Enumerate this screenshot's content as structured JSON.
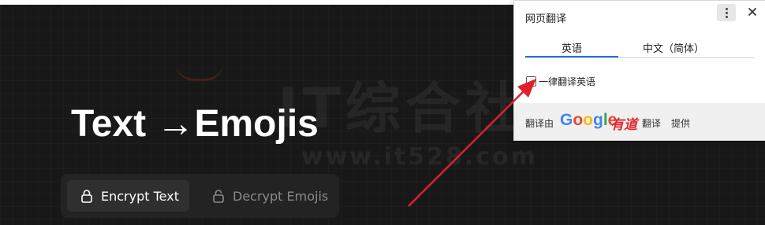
{
  "page": {
    "hero_title": "Text →Emojis",
    "watermark": "IT综合社区",
    "watermark_url": "www.it528.com",
    "modes": [
      {
        "label": "Encrypt Text",
        "icon": "lock-icon",
        "active": true
      },
      {
        "label": "Decrypt Emojis",
        "icon": "unlock-icon",
        "active": false
      }
    ]
  },
  "translate_popup": {
    "title": "网页翻译",
    "tabs": [
      {
        "label": "英语",
        "selected": true
      },
      {
        "label": "中文（简体）",
        "selected": false
      }
    ],
    "always_translate_label": "一律翻译英语",
    "always_translate_checked": false,
    "footer": {
      "prefix": "翻译由",
      "google_letters": [
        "G",
        "o",
        "o",
        "g",
        "l",
        "e"
      ],
      "youdao": "有道",
      "fanyi": "翻译",
      "suffix": "提供"
    }
  },
  "colors": {
    "page_background": "#181818",
    "hero_text": "#ffffff",
    "switch_background": "#232323",
    "active_mode_background": "#2f2f2f",
    "inactive_mode_text": "#8a8a8a",
    "tab_underline": "#1a73e8",
    "annotation_arrow": "#e0202a",
    "google_blue": "#4285f4",
    "google_red": "#ea4335",
    "google_yellow": "#fbbc05",
    "google_green": "#34a853",
    "youdao_red": "#e5262a"
  }
}
